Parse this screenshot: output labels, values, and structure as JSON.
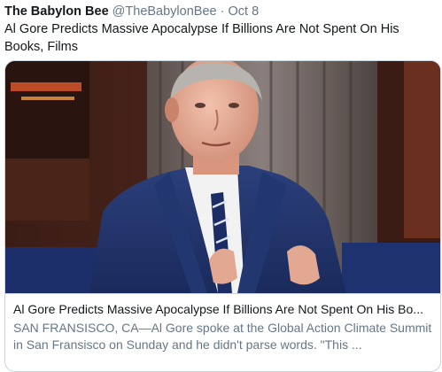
{
  "tweet": {
    "author_name": "The Babylon Bee",
    "author_handle": "@TheBabylonBee",
    "separator": "·",
    "date": "Oct 8",
    "text": "Al Gore Predicts Massive Apocalypse If Billions Are Not Spent On His Books, Films"
  },
  "card": {
    "title": "Al Gore Predicts Massive Apocalypse If Billions Are Not Spent On His Bo...",
    "description": "SAN FRANSISCO, CA—Al Gore spoke at the Global Action Climate Summit in San Fransisco on Sunday and he didn't parse words. \"This ..."
  },
  "colors": {
    "text_primary": "#14171a",
    "text_secondary": "#657786",
    "border": "#ccd6dd"
  }
}
